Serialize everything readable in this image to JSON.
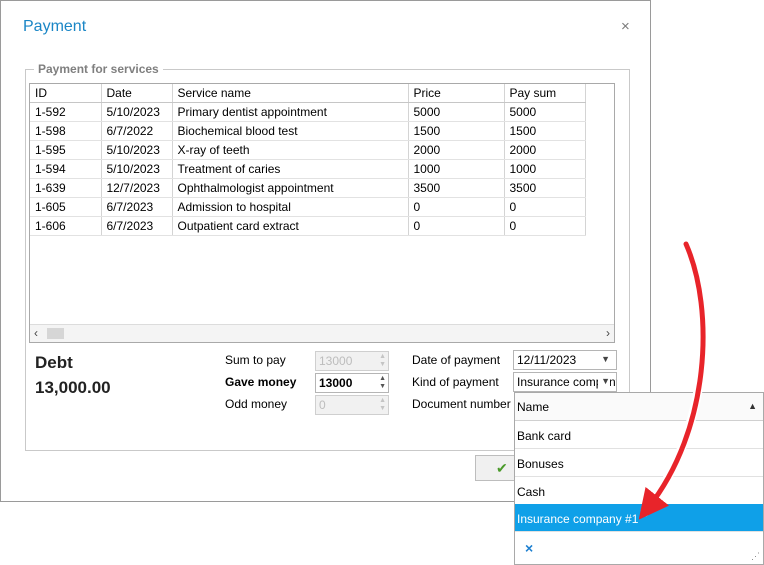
{
  "dialog": {
    "title": "Payment",
    "close_label": "×"
  },
  "group": {
    "title": "Payment for services"
  },
  "grid": {
    "columns": [
      "ID",
      "Date",
      "Service name",
      "Price",
      "Pay sum"
    ],
    "rows": [
      [
        "1-592",
        "5/10/2023",
        "Primary dentist appointment",
        "5000",
        "5000"
      ],
      [
        "1-598",
        "6/7/2022",
        "Biochemical blood test",
        "1500",
        "1500"
      ],
      [
        "1-595",
        "5/10/2023",
        "X-ray of teeth",
        "2000",
        "2000"
      ],
      [
        "1-594",
        "5/10/2023",
        "Treatment of caries",
        "1000",
        "1000"
      ],
      [
        "1-639",
        "12/7/2023",
        "Ophthalmologist appointment",
        "3500",
        "3500"
      ],
      [
        "1-605",
        "6/7/2023",
        "Admission to hospital",
        "0",
        "0"
      ],
      [
        "1-606",
        "6/7/2023",
        "Outpatient card extract",
        "0",
        "0"
      ]
    ]
  },
  "debt": {
    "label": "Debt",
    "value": "13,000.00"
  },
  "form": {
    "sum_to_pay_label": "Sum to pay",
    "sum_to_pay_value": "13000",
    "gave_money_label": "Gave money",
    "gave_money_value": "13000",
    "odd_money_label": "Odd money",
    "odd_money_value": "0",
    "date_label": "Date of payment",
    "date_value": "12/11/2023",
    "kind_label": "Kind of payment",
    "kind_value": "Insurance company #1",
    "document_label": "Document number"
  },
  "dropdown": {
    "header": "Name",
    "options": [
      "Bank card",
      "Bonuses",
      "Cash",
      "Insurance company #1"
    ],
    "selected_index": 3,
    "clear_label": "×"
  },
  "colors": {
    "accent": "#1a86c6",
    "selection": "#0fa0e8",
    "annotation_arrow": "#e8242a"
  }
}
